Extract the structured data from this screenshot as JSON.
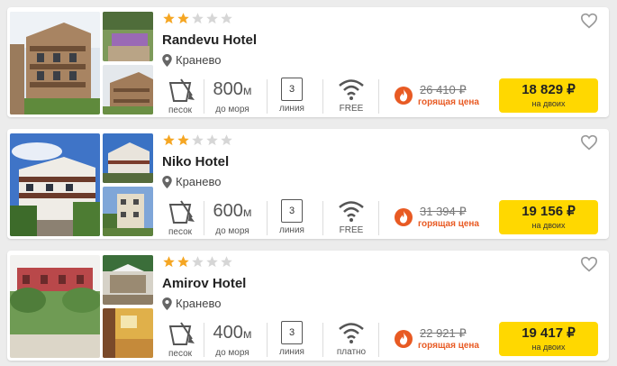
{
  "colors": {
    "accent": "#ffd800",
    "hot": "#e85a23",
    "star_on": "#f5a623",
    "star_off": "#d6d6d6"
  },
  "hotels": [
    {
      "name": "Randevu Hotel",
      "stars": 2,
      "location": "Кранево",
      "beach_label": "песок",
      "distance": "800",
      "distance_unit": "м",
      "distance_label": "до моря",
      "line_number": "3",
      "line_label": "линия",
      "wifi_label": "FREE",
      "old_price": "26 410 ₽",
      "hot_label": "горящая цена",
      "price": "18 829 ₽",
      "price_sub": "на двоих"
    },
    {
      "name": "Niko Hotel",
      "stars": 2,
      "location": "Кранево",
      "beach_label": "песок",
      "distance": "600",
      "distance_unit": "м",
      "distance_label": "до моря",
      "line_number": "3",
      "line_label": "линия",
      "wifi_label": "FREE",
      "old_price": "31 394 ₽",
      "hot_label": "горящая цена",
      "price": "19 156 ₽",
      "price_sub": "на двоих"
    },
    {
      "name": "Amirov Hotel",
      "stars": 2,
      "location": "Кранево",
      "beach_label": "песок",
      "distance": "400",
      "distance_unit": "м",
      "distance_label": "до моря",
      "line_number": "3",
      "line_label": "линия",
      "wifi_label": "платно",
      "old_price": "22 921 ₽",
      "hot_label": "горящая цена",
      "price": "19 417 ₽",
      "price_sub": "на двоих"
    }
  ]
}
